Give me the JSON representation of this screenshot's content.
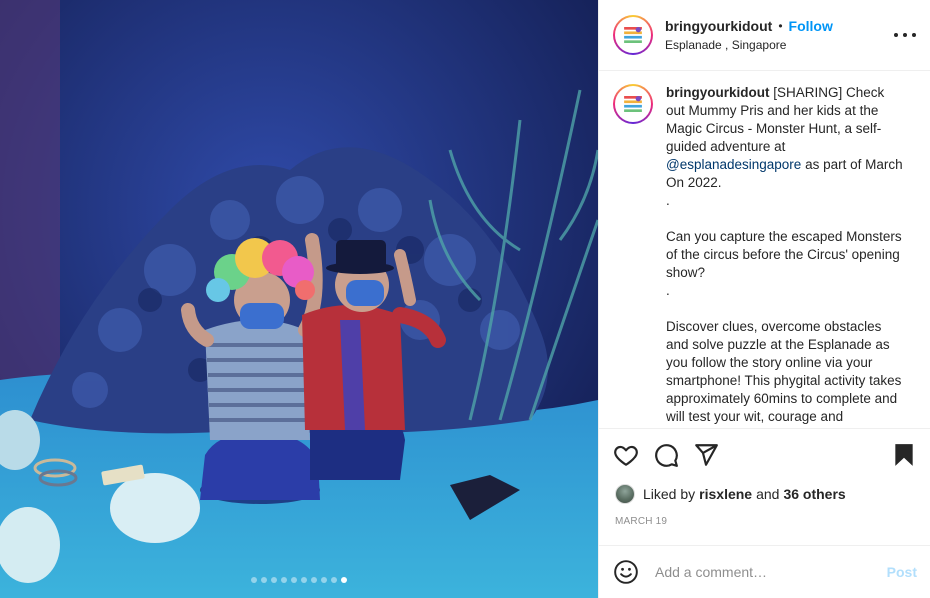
{
  "post": {
    "image_alt": "Two children in costumes posing in front of a camouflage net backdrop",
    "carousel": {
      "count": 10,
      "active_index": 9
    }
  },
  "header": {
    "username": "bringyourkidout",
    "separator": "•",
    "follow_label": "Follow",
    "location": "Esplanade , Singapore"
  },
  "caption": {
    "username": "bringyourkidout",
    "text_before_mention": "[SHARING] Check out Mummy Pris and her kids at the Magic Circus - Monster Hunt, a self-guided adventure at ",
    "mention": "@esplanadesingapore",
    "text_after_mention": " as part of March On 2022.\n.\n\nCan you capture the escaped Monsters of the circus before the Circus' opening show?\n.\n\nDiscover clues, overcome obstacles and solve puzzle at the Esplanade as you follow the story online via your smartphone! This phygital activity takes approximately 60mins to complete and will test your wit, courage and compassion!"
  },
  "actions": {
    "like_icon": "heart-icon",
    "comment_icon": "comment-icon",
    "share_icon": "share-icon",
    "save_icon": "bookmark-icon"
  },
  "likes": {
    "prefix": "Liked by",
    "user": "risxlene",
    "joiner": "and",
    "others": "36 others"
  },
  "date": "MARCH 19",
  "comment": {
    "placeholder": "Add a comment…",
    "post_label": "Post"
  }
}
